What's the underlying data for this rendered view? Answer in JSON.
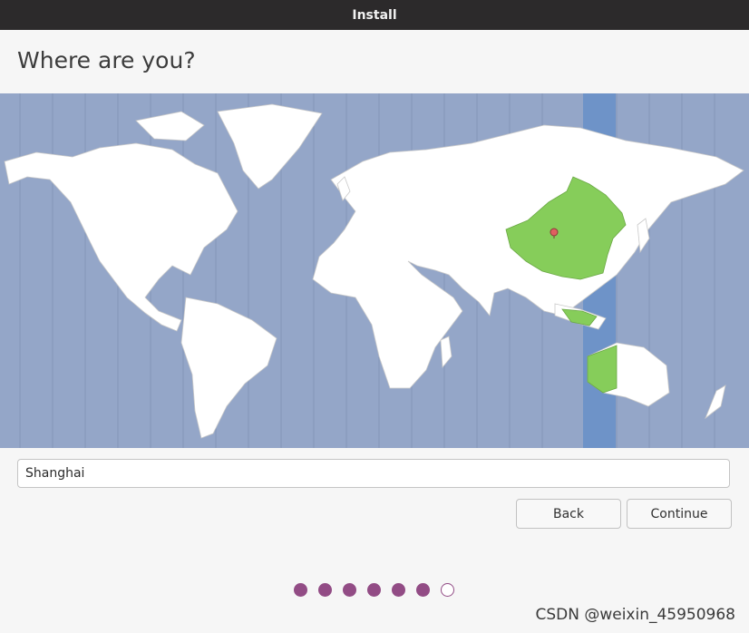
{
  "window": {
    "title": "Install"
  },
  "page": {
    "heading": "Where are you?"
  },
  "map": {
    "selected_location": "Shanghai",
    "colors": {
      "ocean": "#94a6c8",
      "land": "#ffffff",
      "selected_zone": "#86cd5a",
      "selected_band": "#6e93c8",
      "pin": "#e06060"
    }
  },
  "location": {
    "value": "Shanghai"
  },
  "buttons": {
    "back": "Back",
    "continue": "Continue"
  },
  "progress": {
    "total_steps": 7,
    "completed_steps": 6
  },
  "watermark": {
    "text": "CSDN @weixin_45950968"
  }
}
